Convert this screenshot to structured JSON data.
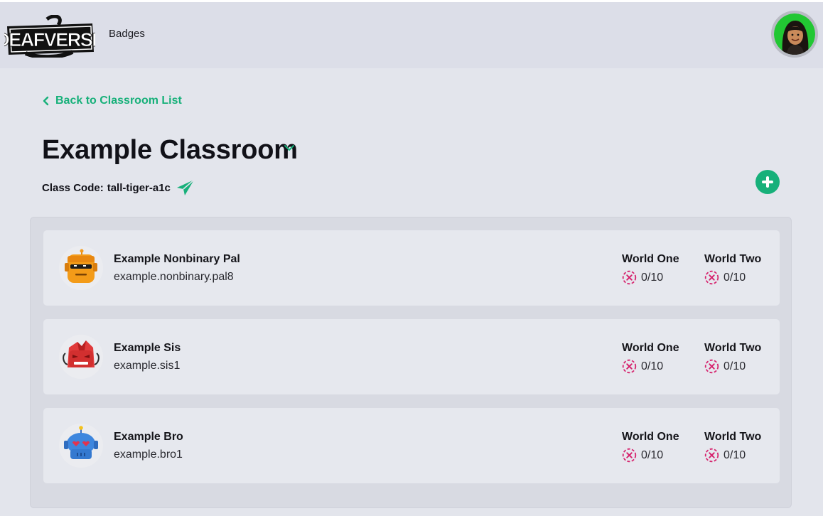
{
  "header": {
    "logo_text": "DEAFVERSE",
    "nav_badges": "Badges",
    "user_avatar_icon": "user-avatar-icon"
  },
  "back_link": "Back to Classroom List",
  "classroom": {
    "title": "Example Classroom",
    "class_code_label": "Class Code:",
    "class_code": "tall-tiger-a1c"
  },
  "colors": {
    "accent": "#16b079",
    "status_incomplete": "#d6246e",
    "background": "#e3e5ec"
  },
  "students": [
    {
      "name": "Example Nonbinary Pal",
      "username": "example.nonbinary.pal8",
      "avatar_icon": "orange-robot-icon",
      "worlds": [
        {
          "title": "World One",
          "progress": "0/10"
        },
        {
          "title": "World Two",
          "progress": "0/10"
        }
      ]
    },
    {
      "name": "Example Sis",
      "username": "example.sis1",
      "avatar_icon": "red-robot-icon",
      "worlds": [
        {
          "title": "World One",
          "progress": "0/10"
        },
        {
          "title": "World Two",
          "progress": "0/10"
        }
      ]
    },
    {
      "name": "Example Bro",
      "username": "example.bro1",
      "avatar_icon": "blue-robot-icon",
      "worlds": [
        {
          "title": "World One",
          "progress": "0/10"
        },
        {
          "title": "World Two",
          "progress": "0/10"
        }
      ]
    }
  ]
}
